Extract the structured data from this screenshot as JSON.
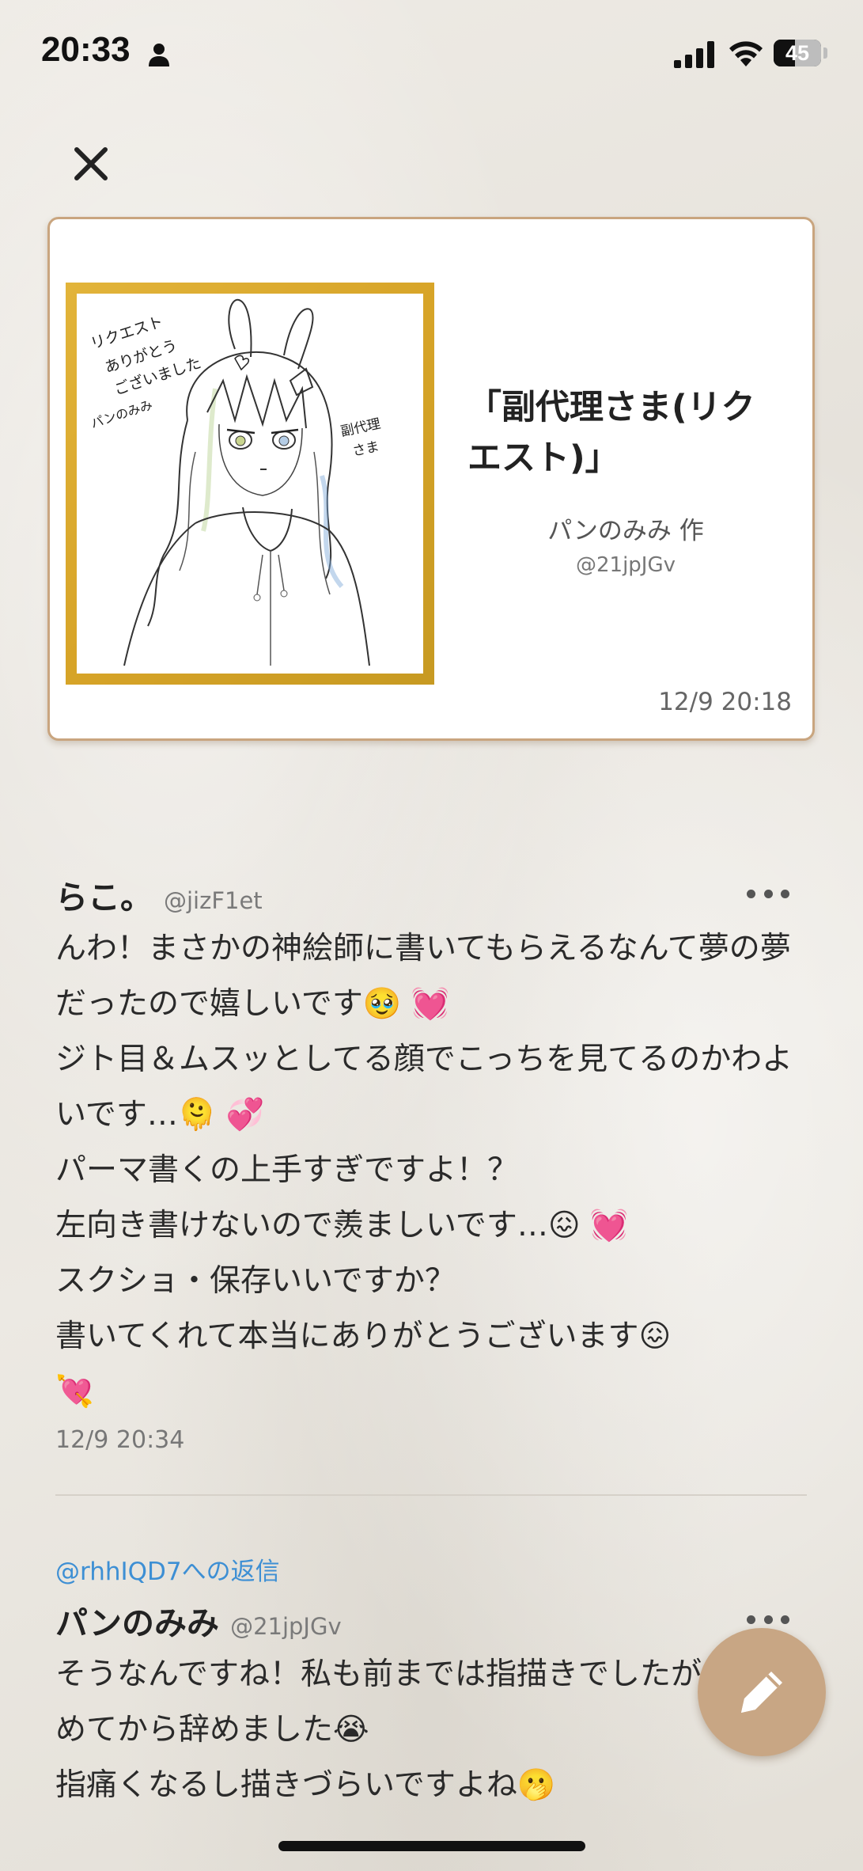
{
  "status_bar": {
    "time": "20:33",
    "battery_percent": 45,
    "battery_label": "45"
  },
  "artwork": {
    "title": "「副代理さま(リクエスト)」",
    "author": "パンのみみ 作",
    "handle": "@21jpJGv",
    "timestamp": "12/9 20:18",
    "shikishi_text_left": [
      "リクエスト",
      "ありがとう",
      "ございました",
      "パンのみみ"
    ],
    "shikishi_text_right": [
      "副代理",
      "さま"
    ]
  },
  "comments": [
    {
      "name": "らこ。",
      "handle": "@jizF1et",
      "body": "んわ！まさかの神絵師に書いてもらえるなんて夢の夢だったので嬉しいです🥹 💓\nジト目＆ムスッとしてる顔でこっちを見てるのかわよいです…🫠 💞\nパーマ書くの上手すぎですよ！？\n左向き書けないので羨ましいです…😖 💓\nスクショ・保存いいですか？\n書いてくれて本当にありがとうございます😖\n💘",
      "timestamp": "12/9 20:34"
    },
    {
      "reply_to": "@rhhIQD7への返信",
      "name": "パンのみみ",
      "handle": "@21jpJGv",
      "body": "そうなんですね！私も前までは指描きでしたが、指痛めてから辞めました😭\n指痛くなるし描きづらいですよね🫢"
    }
  ],
  "colors": {
    "accent": "#c8a684",
    "card_border": "#c9a57f",
    "frame_gold": "#d7a428",
    "link": "#3d8fd4"
  },
  "icons": {
    "close": "close-icon",
    "more": "more-icon",
    "compose": "pencil-icon"
  }
}
